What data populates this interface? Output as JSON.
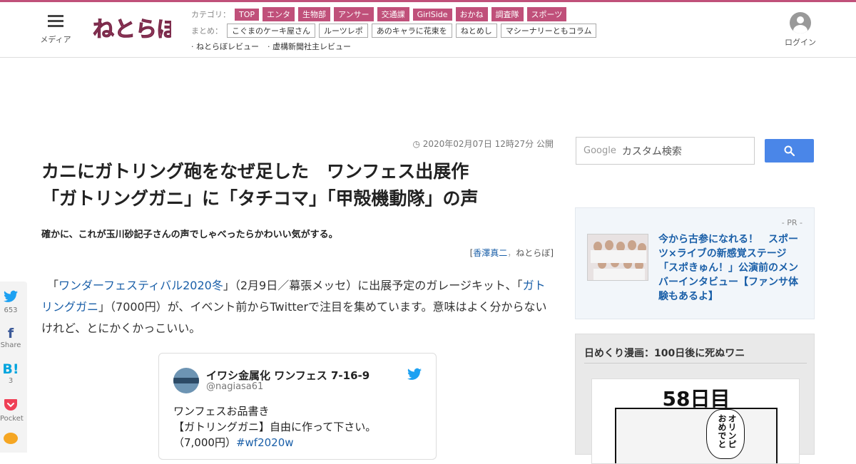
{
  "header": {
    "menu_label": "メディア",
    "logo_text": "ねとらぼ",
    "category_label": "カテゴリ：",
    "categories": [
      "TOP",
      "エンタ",
      "生物部",
      "アンサー",
      "交通課",
      "GirlSide",
      "おかね",
      "調査隊",
      "スポーツ"
    ],
    "summary_label": "まとめ：",
    "summaries": [
      "こぐまのケーキ屋さん",
      "ルーツレポ",
      "あのキャラに花束を",
      "ねとめし",
      "マシーナリーともコラム"
    ],
    "reviews": [
      "ねとらぼレビュー",
      "虚構新聞社主レビュー"
    ],
    "login_label": "ログイン"
  },
  "share": {
    "twitter": {
      "icon": "twitter-icon",
      "count": "653"
    },
    "facebook": {
      "icon": "facebook-icon",
      "label": "Share"
    },
    "hatena": {
      "icon": "hatena-icon",
      "glyph": "B!",
      "count": "3"
    },
    "pocket": {
      "icon": "pocket-icon",
      "label": "Pocket"
    }
  },
  "article": {
    "date": "2020年02月07日 12時27分 公開",
    "title_line1": "カニにガトリング砲をなぜ足した　ワンフェス出展作",
    "title_line2": "「ガトリングガニ」に「タチコマ」「甲殻機動隊」の声",
    "subtitle": "確かに、これが玉川砂記子さんの声でしゃべったらかわいい気がする。",
    "author_open": "[",
    "author_name": "香澤真二",
    "author_sep": "，",
    "author_site": "ねとらぼ",
    "author_close": "]",
    "body_pre": "　「",
    "body_link1": "ワンダーフェスティバル2020冬",
    "body_mid1": "」（2月9日／幕張メッセ）に出展予定のガレージキット、「",
    "body_link2": "ガトリングガニ",
    "body_post": "」（7000円）が、イベント前からTwitterで注目を集めています。意味はよく分からないけれど、とにかくかっこいい。"
  },
  "tweet": {
    "name": "イワシ金属化 ワンフェス 7-16-9",
    "handle": "@nagiasa61",
    "line1": "ワンフェスお品書き",
    "line2": "【ガトリングガニ】自由に作って下さい。",
    "line3_pre": "（7,000円）",
    "hashtag": "#wf2020w"
  },
  "sidebar": {
    "search_brand": "Google",
    "search_placeholder": "カスタム検索",
    "pr_label": "- PR -",
    "pr_text": "今から古参になれる！　スポーツ×ライブの新感覚ステージ「スポきゅん！」公演前のメンバーインタビュー【ファンサ体験もあるよ】",
    "comic_title": "日めくり漫画：100日後に死ぬワニ",
    "comic_day": "58日目",
    "comic_bubble": "オリンピおめでと"
  },
  "colors": {
    "brand": "#c0507a",
    "link": "#1a5fa8",
    "search_button": "#4a86e8",
    "twitter": "#1da1f2",
    "facebook": "#3b5998",
    "hatena": "#00a4de",
    "pocket": "#ef4056"
  }
}
